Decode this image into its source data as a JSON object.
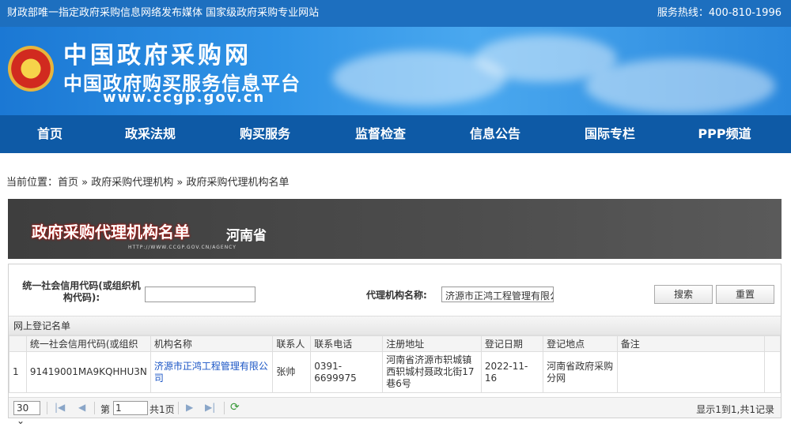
{
  "topbar": {
    "left": "财政部唯一指定政府采购信息网络发布媒体 国家级政府采购专业网站",
    "right": "服务热线：400-810-1996"
  },
  "banner": {
    "title": "中国政府采购网",
    "subtitle": "中国政府购买服务信息平台",
    "url": "www.ccgp.gov.cn"
  },
  "nav": [
    "首页",
    "政采法规",
    "购买服务",
    "监督检查",
    "信息公告",
    "国际专栏",
    "PPP频道"
  ],
  "breadcrumb": {
    "prefix": "当前位置：",
    "items": [
      "首页",
      "政府采购代理机构",
      "政府采购代理机构名单"
    ],
    "sep": " » "
  },
  "ribbon": {
    "title": "政府采购代理机构名单",
    "province": "河南省",
    "url": "HTTP://WWW.CCGP.GOV.CN/AGENCY"
  },
  "search": {
    "code_label": "统一社会信用代码(或组织机构代码):",
    "code_value": "",
    "name_label": "代理机构名称:",
    "name_value": "济源市正鸿工程管理有限公",
    "search_btn": "搜索",
    "reset_btn": "重置"
  },
  "grid": {
    "title": "网上登记名单",
    "columns": [
      "",
      "统一社会信用代码(或组织",
      "机构名称",
      "联系人",
      "联系电话",
      "注册地址",
      "登记日期",
      "登记地点",
      "备注"
    ],
    "rows": [
      [
        "1",
        "91419001MA9KQHHU3N",
        "济源市正鸿工程管理有限公司",
        "张帅",
        "0391-6699975",
        "河南省济源市轵城镇西轵城村聂政北街17巷6号",
        "2022-11-16",
        "河南省政府采购分网",
        ""
      ]
    ]
  },
  "pager": {
    "page_size": "30",
    "page_label": "第",
    "page_value": "1",
    "total_pages": "共1页",
    "info": "显示1到1,共1记录"
  }
}
